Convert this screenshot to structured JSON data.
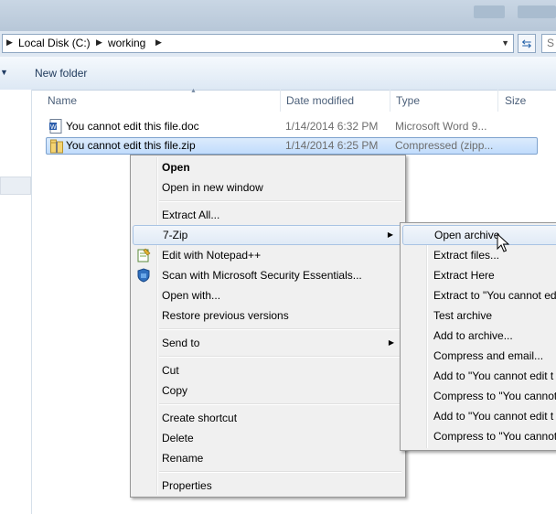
{
  "address": {
    "crumbs": [
      "Local Disk (C:)",
      "working"
    ]
  },
  "toolbar": {
    "new_folder": "New folder"
  },
  "columns": {
    "name": "Name",
    "date": "Date modified",
    "type": "Type",
    "size": "Size"
  },
  "files": [
    {
      "name": "You cannot edit this file.doc",
      "date": "1/14/2014 6:32 PM",
      "type": "Microsoft Word 9...",
      "icon": "word-doc-icon"
    },
    {
      "name": "You cannot edit this file.zip",
      "date": "1/14/2014 6:25 PM",
      "type": "Compressed (zipp...",
      "icon": "zip-folder-icon"
    }
  ],
  "context_menu": {
    "open": "Open",
    "open_new_window": "Open in new window",
    "extract_all": "Extract All...",
    "seven_zip": "7-Zip",
    "edit_notepad": "Edit with Notepad++",
    "scan_mse": "Scan with Microsoft Security Essentials...",
    "open_with": "Open with...",
    "restore_versions": "Restore previous versions",
    "send_to": "Send to",
    "cut": "Cut",
    "copy": "Copy",
    "create_shortcut": "Create shortcut",
    "delete": "Delete",
    "rename": "Rename",
    "properties": "Properties"
  },
  "zip_submenu": {
    "open_archive": "Open archive",
    "extract_files": "Extract files...",
    "extract_here": "Extract Here",
    "extract_to": "Extract to \"You cannot edi",
    "test_archive": "Test archive",
    "add_to_archive": "Add to archive...",
    "compress_email": "Compress and email...",
    "add_to_7z": "Add to \"You cannot edit t",
    "compress_to_7z": "Compress to \"You cannot",
    "add_to_zip": "Add to \"You cannot edit t",
    "compress_to_zip": "Compress to \"You cannot"
  },
  "colors": {
    "selection": "#c1dcfc",
    "menu_bg": "#f0f0f0",
    "hover_border": "#a8c3e4"
  }
}
